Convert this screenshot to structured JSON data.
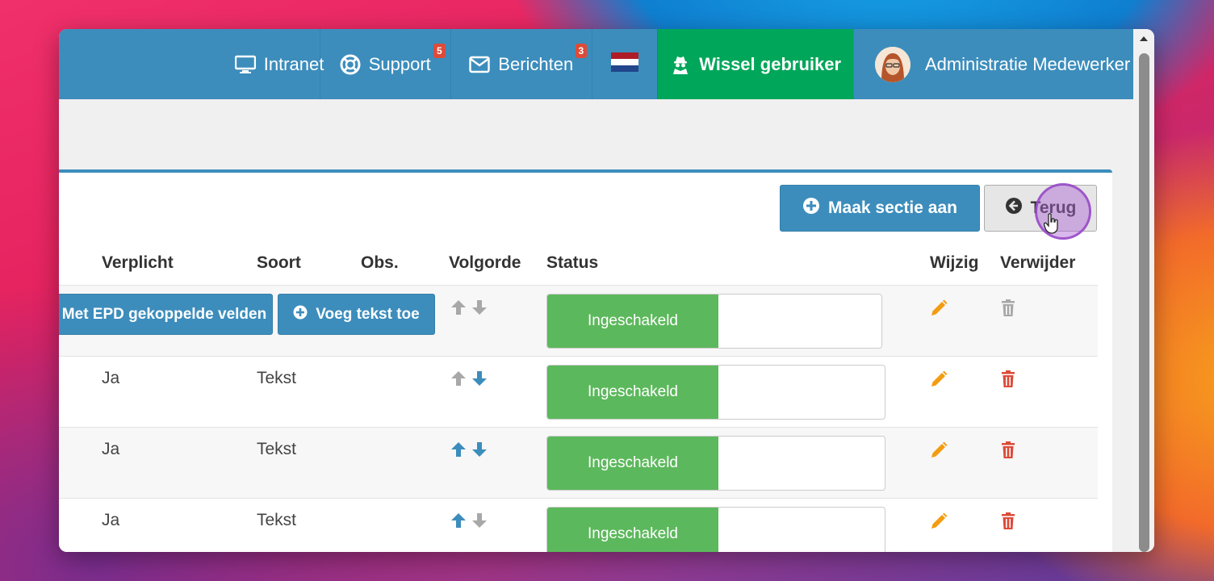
{
  "nav": {
    "intranet": "Intranet",
    "support": "Support",
    "support_badge": "5",
    "berichten": "Berichten",
    "berichten_badge": "3",
    "wissel": "Wissel gebruiker",
    "user": "Administratie Medewerker"
  },
  "toolbar": {
    "maak_label": "Maak sectie aan",
    "terug_label": "Terug"
  },
  "table": {
    "headers": {
      "verplicht": "Verplicht",
      "soort": "Soort",
      "obs": "Obs.",
      "volgorde": "Volgorde",
      "status": "Status",
      "wijzig": "Wijzig",
      "verwijder": "Verwijder"
    },
    "section_row": {
      "epd_button": "Met EPD gekoppelde velden",
      "voeg_button": "Voeg tekst toe",
      "status": "Ingeschakeld"
    },
    "rows": [
      {
        "verplicht": "Ja",
        "soort": "Tekst",
        "status": "Ingeschakeld"
      },
      {
        "verplicht": "Ja",
        "soort": "Tekst",
        "status": "Ingeschakeld"
      },
      {
        "verplicht": "Ja",
        "soort": "Tekst",
        "status": "Ingeschakeld"
      }
    ]
  },
  "colors": {
    "primary": "#3c8dbc",
    "success": "#00a65a",
    "status_green": "#5cb85c",
    "edit_orange": "#f39c12",
    "delete_red": "#dd4b39",
    "disabled_gray": "#a8a8a8"
  }
}
